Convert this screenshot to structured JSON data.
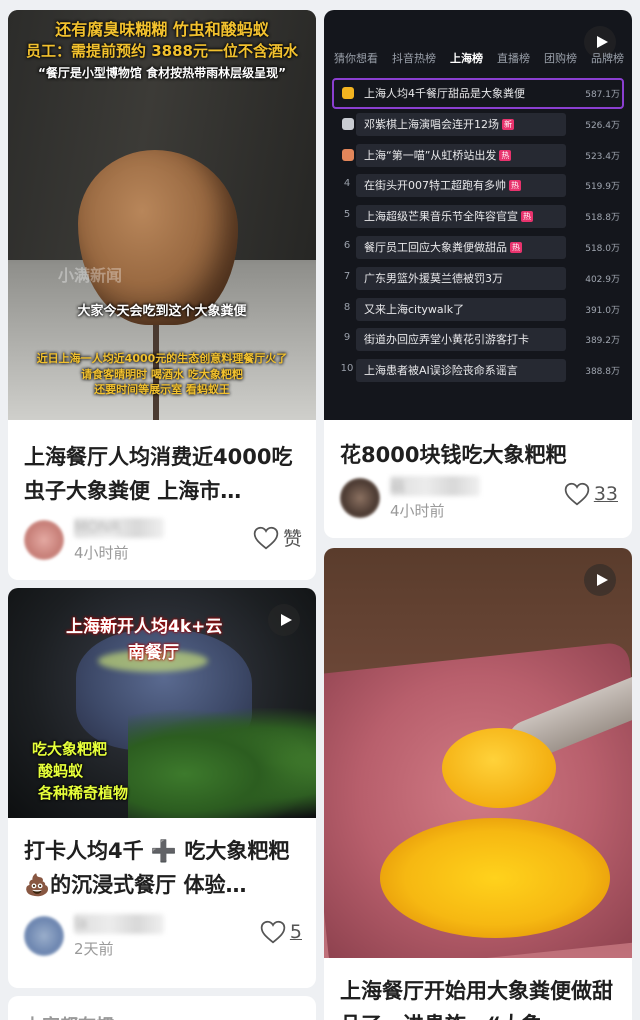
{
  "cards": [
    {
      "title": "上海餐厅人均消费近4000吃虫子大象粪便 上海市…",
      "author": "MONR",
      "time": "4小时前",
      "like": "赞",
      "overlay": {
        "line1": "还有腐臭味糊糊 竹虫和酸蚂蚁",
        "line2": "员工：需提前预约 3888元一位不含酒水",
        "line3": "“餐厅是小型博物馆 食材按热带雨林层级呈现”",
        "caption": "大家今天会吃到这个大象粪便",
        "watermark": "小满新闻",
        "sub1": "近日上海一人均近4000元的生态创意料理餐厅火了",
        "sub2": "请食客晴明时 喝酒水 吃大象粑粑",
        "sub3": "还要时间等展示室 看蚂蚁王"
      }
    },
    {
      "title": "花8000块钱吃大象粑粑",
      "author": "萌",
      "time": "4小时前",
      "like": "33",
      "tabs": [
        "猜你想看",
        "抖音热榜",
        "上海榜",
        "直播榜",
        "团购榜",
        "品牌榜"
      ],
      "active_tab": "上海榜",
      "ranking": [
        {
          "no": "1",
          "text": "上海人均4千餐厅甜品是大象粪便",
          "heat": "587.1万",
          "tag": ""
        },
        {
          "no": "2",
          "text": "邓紫棋上海演唱会连开12场",
          "heat": "526.4万",
          "tag": "新"
        },
        {
          "no": "3",
          "text": "上海“第一喵”从虹桥站出发",
          "heat": "523.4万",
          "tag": "热"
        },
        {
          "no": "4",
          "text": "在街头开007特工超跑有多帅",
          "heat": "519.9万",
          "tag": "热"
        },
        {
          "no": "5",
          "text": "上海超级芒果音乐节全阵容官宣",
          "heat": "518.8万",
          "tag": "热"
        },
        {
          "no": "6",
          "text": "餐厅员工回应大象粪便做甜品",
          "heat": "518.0万",
          "tag": "热"
        },
        {
          "no": "7",
          "text": "广东男篮外援莫兰德被罚3万",
          "heat": "402.9万",
          "tag": ""
        },
        {
          "no": "8",
          "text": "又来上海citywalk了",
          "heat": "391.0万",
          "tag": ""
        },
        {
          "no": "9",
          "text": "街道办回应弄堂小黄花引游客打卡",
          "heat": "389.2万",
          "tag": ""
        },
        {
          "no": "10",
          "text": "上海患者被AI误诊险丧命系谣言",
          "heat": "388.8万",
          "tag": ""
        }
      ]
    },
    {
      "title": "打卡人均4千 ➕ 吃大象粑粑💩的沉浸式餐厅 体验…",
      "author": "la",
      "time": "2天前",
      "like": "5",
      "overlay": {
        "line1": "上海新开人均4k+云",
        "line2": "南餐厅",
        "line3": "吃大象粑粑",
        "line4": "酸蚂蚁",
        "line5": "各种稀奇植物"
      }
    },
    {
      "title": "上海餐厅开始用大象粪便做甜品了，进贵族…“大象",
      "author": "",
      "time": "",
      "like": ""
    }
  ],
  "partial_bottom_title": "上家都有惯"
}
